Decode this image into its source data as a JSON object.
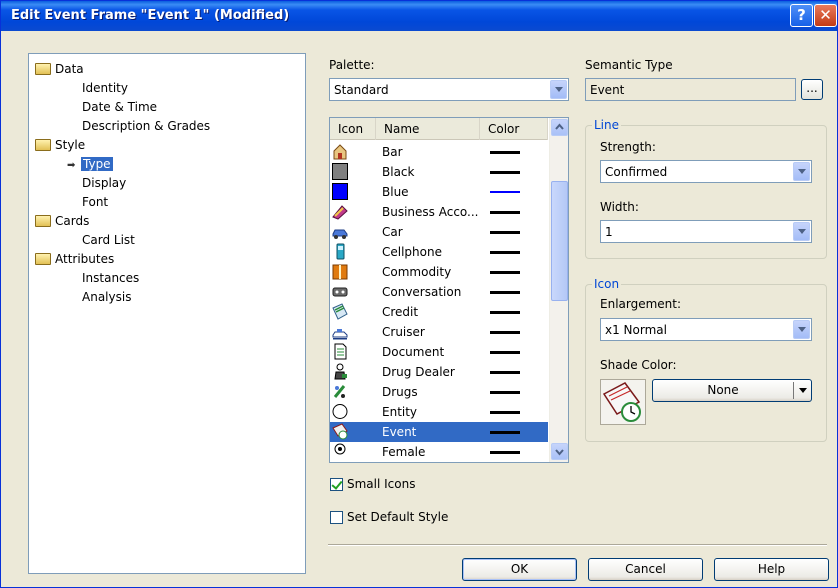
{
  "window": {
    "title": "Edit Event Frame \"Event 1\" (Modified)",
    "help_glyph": "?",
    "close_glyph": "✕"
  },
  "tree": {
    "items": [
      {
        "label": "Data",
        "level": 0,
        "folder": true
      },
      {
        "label": "Identity",
        "level": 1
      },
      {
        "label": "Date & Time",
        "level": 1
      },
      {
        "label": "Description & Grades",
        "level": 1
      },
      {
        "label": "Style",
        "level": 0,
        "folder": true
      },
      {
        "label": "Type",
        "level": 1,
        "selected": true
      },
      {
        "label": "Display",
        "level": 1
      },
      {
        "label": "Font",
        "level": 1
      },
      {
        "label": "Cards",
        "level": 0,
        "folder": true
      },
      {
        "label": "Card List",
        "level": 1
      },
      {
        "label": "Attributes",
        "level": 0,
        "folder": true
      },
      {
        "label": "Instances",
        "level": 1
      },
      {
        "label": "Analysis",
        "level": 1
      }
    ]
  },
  "palette": {
    "label": "Palette:",
    "value": "Standard"
  },
  "list": {
    "columns": [
      "Icon",
      "Name",
      "Color"
    ],
    "rows": [
      {
        "name": "Bar",
        "color": "#000000"
      },
      {
        "name": "Black",
        "color": "#000000"
      },
      {
        "name": "Blue",
        "color": "#0000ff"
      },
      {
        "name": "Business Acco...",
        "color": "#000000"
      },
      {
        "name": "Car",
        "color": "#000000"
      },
      {
        "name": "Cellphone",
        "color": "#000000"
      },
      {
        "name": "Commodity",
        "color": "#000000"
      },
      {
        "name": "Conversation",
        "color": "#000000"
      },
      {
        "name": "Credit",
        "color": "#000000"
      },
      {
        "name": "Cruiser",
        "color": "#000000"
      },
      {
        "name": "Document",
        "color": "#000000"
      },
      {
        "name": "Drug Dealer",
        "color": "#000000"
      },
      {
        "name": "Drugs",
        "color": "#000000"
      },
      {
        "name": "Entity",
        "color": "#000000"
      },
      {
        "name": "Event",
        "color": "#000000",
        "selected": true
      },
      {
        "name": "Female",
        "color": "#000000"
      }
    ]
  },
  "semantic_type": {
    "label": "Semantic Type",
    "value": "Event",
    "browse_label": "..."
  },
  "line_group": {
    "title": "Line",
    "strength_label": "Strength:",
    "strength_value": "Confirmed",
    "width_label": "Width:",
    "width_value": "1"
  },
  "icon_group": {
    "title": "Icon",
    "enlargement_label": "Enlargement:",
    "enlargement_value": "x1 Normal",
    "shade_label": "Shade Color:",
    "shade_value": "None"
  },
  "options": {
    "small_icons_label": "Small Icons",
    "small_icons_checked": true,
    "default_style_label": "Set Default Style",
    "default_style_checked": false
  },
  "buttons": {
    "ok": "OK",
    "cancel": "Cancel",
    "help": "Help"
  },
  "colors": {
    "title_bar": "#0b55e3",
    "selection": "#316ac5",
    "group_title": "#0046d5"
  }
}
